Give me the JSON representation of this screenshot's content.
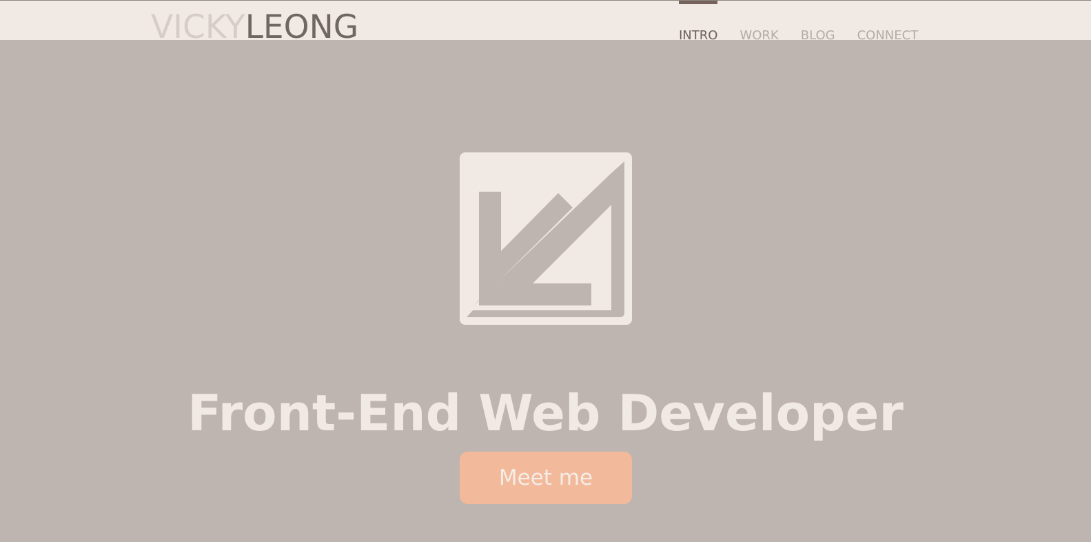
{
  "header": {
    "logo_first": "VICKY",
    "logo_last": "LEONG",
    "nav": [
      {
        "label": "INTRO",
        "active": true
      },
      {
        "label": "WORK",
        "active": false
      },
      {
        "label": "BLOG",
        "active": false
      },
      {
        "label": "CONNECT",
        "active": false
      }
    ]
  },
  "hero": {
    "logo_icon": "vl-monogram-icon",
    "title": "Front-End Web Developer",
    "button_label": "Meet me"
  },
  "colors": {
    "header_bg": "#f1e9e4",
    "hero_bg": "#bfb5b0",
    "nav_active": "#6b615c",
    "nav_inactive": "#b3aba7",
    "accent_bar": "#74625b",
    "button_bg": "#f3b99b",
    "hero_text": "#f1e9e4"
  }
}
